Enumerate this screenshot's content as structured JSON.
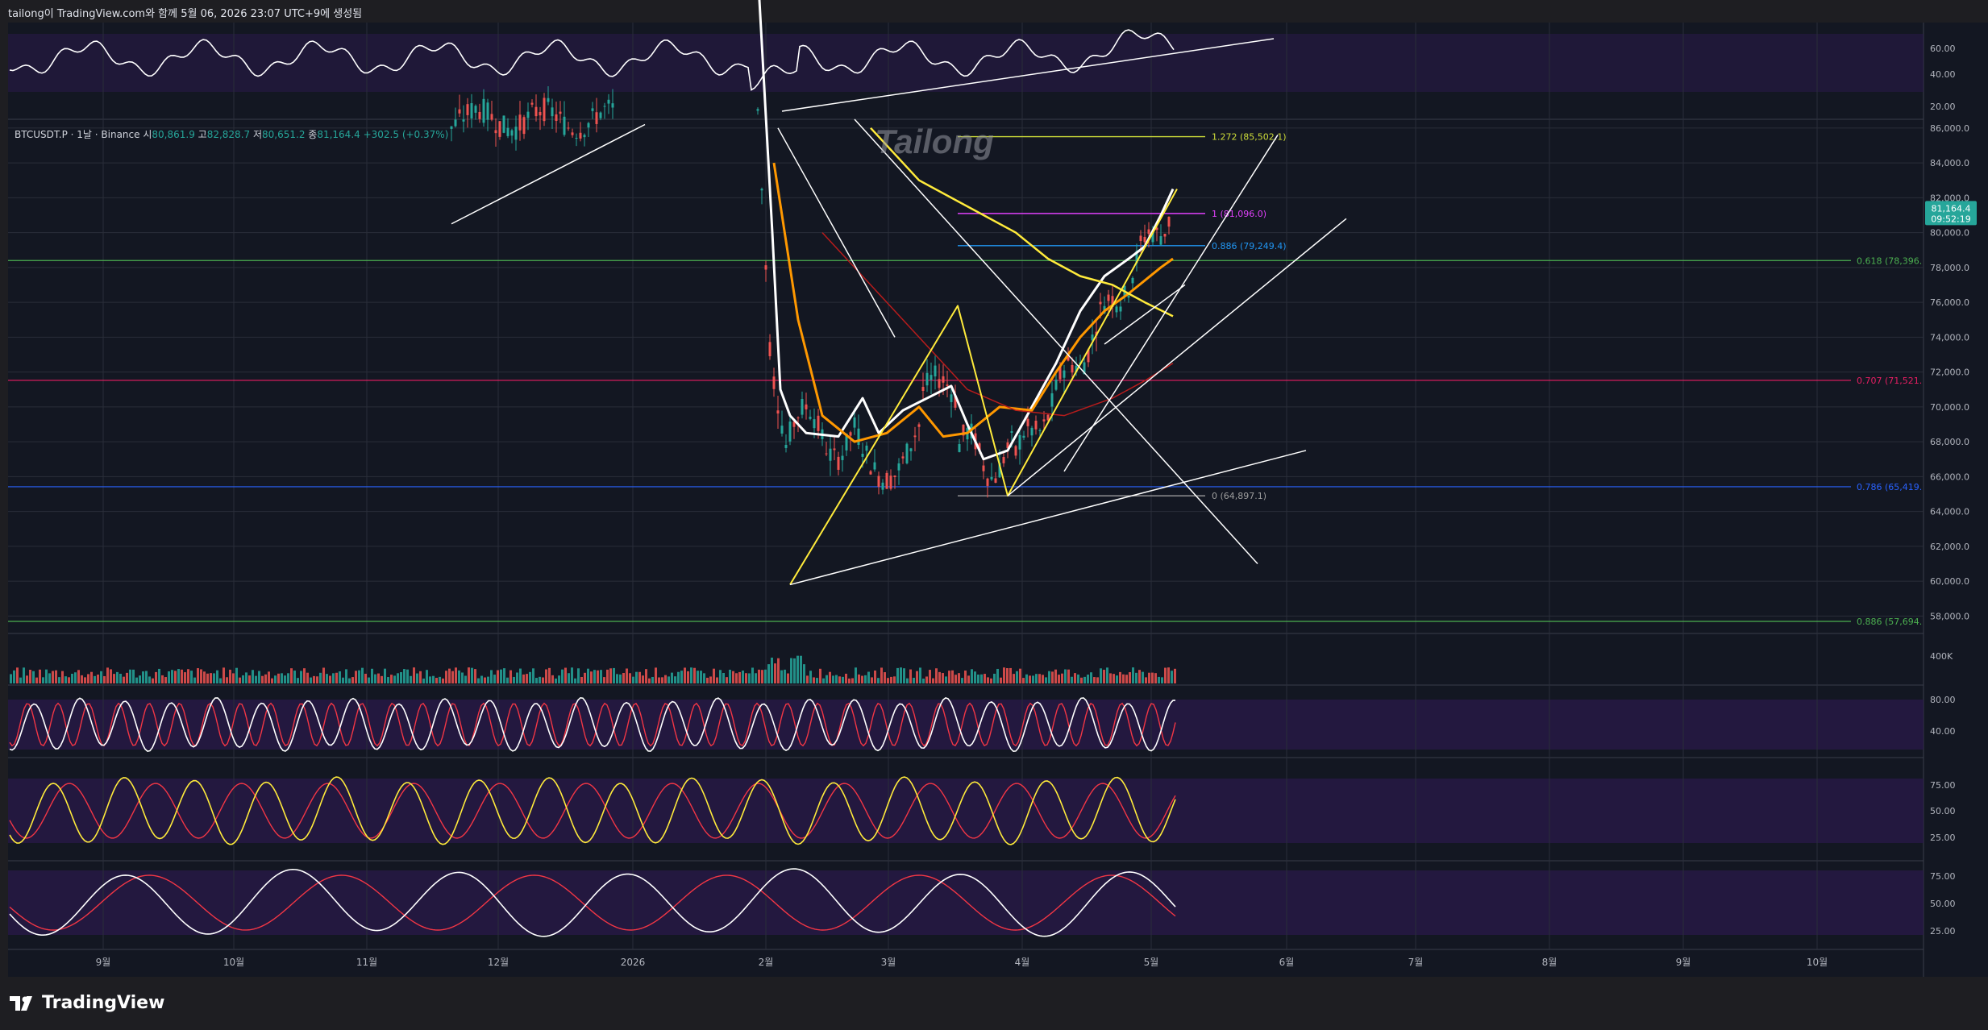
{
  "header": {
    "caption": "tailong이 TradingView.com와 함께 5월 06, 2026 23:07 UTC+9에 생성됨"
  },
  "symbol_line": {
    "symbol": "BTCUSDT.P · 1날 · Binance",
    "open_label": "시",
    "open": "80,861.9",
    "high_label": "고",
    "high": "82,828.7",
    "low_label": "저",
    "low": "80,651.2",
    "close_label": "종",
    "close": "81,164.4",
    "change": "+302.5 (+0.37%)"
  },
  "watermark": "Tailong",
  "footer": {
    "brand": "TradingView"
  },
  "price_badge": {
    "price": "81,164.4",
    "countdown": "09:52:19"
  },
  "colors": {
    "background": "#131722",
    "bull": "#26a69a",
    "bear": "#ef5350",
    "oscillator_fill": "#2a1a4a",
    "fib_0618": "#4caf50",
    "fib_0707": "#e91e63",
    "fib_0786": "#2962ff",
    "fib_0886_low": "#4caf50",
    "fib_1272": "#cddc39",
    "fib_1": "#e040fb",
    "fib_0886_local": "#2196f3",
    "fib_0": "#9e9e9e",
    "wave": "#ffeb3b",
    "ma_white": "#ffffff",
    "ma_orange": "#ff9800",
    "ma_yellow": "#ffeb3b",
    "ma_red": "#b71c1c"
  },
  "chart_data": {
    "type": "candlestick",
    "symbol": "BTCUSDT.P",
    "timeframe": "1날",
    "exchange": "Binance",
    "x_axis_labels": [
      "9월",
      "10월",
      "11월",
      "12월",
      "2026",
      "2월",
      "3월",
      "4월",
      "5월",
      "6월",
      "7월",
      "8월",
      "9월",
      "10월"
    ],
    "price_axis": {
      "ticks": [
        "86,000.0",
        "84,000.0",
        "82,000.0",
        "80,000.0",
        "78,000.0",
        "76,000.0",
        "74,000.0",
        "72,000.0",
        "70,000.0",
        "68,000.0",
        "66,000.0",
        "64,000.0",
        "62,000.0",
        "60,000.0",
        "58,000.0"
      ],
      "range": [
        57000,
        86500
      ]
    },
    "fib_levels_global": [
      {
        "label": "0.618 (78,396.",
        "value": 78396
      },
      {
        "label": "0.707 (71,521.",
        "value": 71521
      },
      {
        "label": "0.786 (65,419.",
        "value": 65419
      },
      {
        "label": "0.886 (57,694.",
        "value": 57694
      }
    ],
    "fib_levels_local": [
      {
        "label": "1.272 (85,502.1)",
        "value": 85502.1
      },
      {
        "label": "1 (81,096.0)",
        "value": 81096.0
      },
      {
        "label": "0.886 (79,249.4)",
        "value": 79249.4
      },
      {
        "label": "0 (64,897.1)",
        "value": 64897.1
      }
    ],
    "close_series": [
      {
        "t": 0.47,
        "v": 90000
      },
      {
        "t": 0.375,
        "v": 86500
      },
      {
        "t": 0.395,
        "v": 72000
      },
      {
        "t": 0.4,
        "v": 63000
      },
      {
        "t": 0.405,
        "v": 71000
      },
      {
        "t": 0.42,
        "v": 68000
      },
      {
        "t": 0.45,
        "v": 67500
      },
      {
        "t": 0.465,
        "v": 69000
      },
      {
        "t": 0.48,
        "v": 71500
      },
      {
        "t": 0.49,
        "v": 69000
      },
      {
        "t": 0.505,
        "v": 68000
      },
      {
        "t": 0.515,
        "v": 66500
      },
      {
        "t": 0.53,
        "v": 67500
      },
      {
        "t": 0.55,
        "v": 70500
      },
      {
        "t": 0.565,
        "v": 74500
      },
      {
        "t": 0.575,
        "v": 77500
      },
      {
        "t": 0.585,
        "v": 76500
      },
      {
        "t": 0.6,
        "v": 80000
      },
      {
        "t": 0.605,
        "v": 81164
      }
    ],
    "volume_axis": {
      "label": "400K"
    },
    "oscillators": [
      {
        "name": "osc1",
        "ticks": [
          "80.00",
          "40.00"
        ]
      },
      {
        "name": "osc2",
        "ticks": [
          "75.00",
          "50.00",
          "25.00"
        ]
      },
      {
        "name": "osc3",
        "ticks": [
          "75.00",
          "50.00",
          "25.00"
        ]
      }
    ],
    "top_indicator": {
      "ticks": [
        "60.00",
        "40.00",
        "20.00"
      ]
    }
  }
}
